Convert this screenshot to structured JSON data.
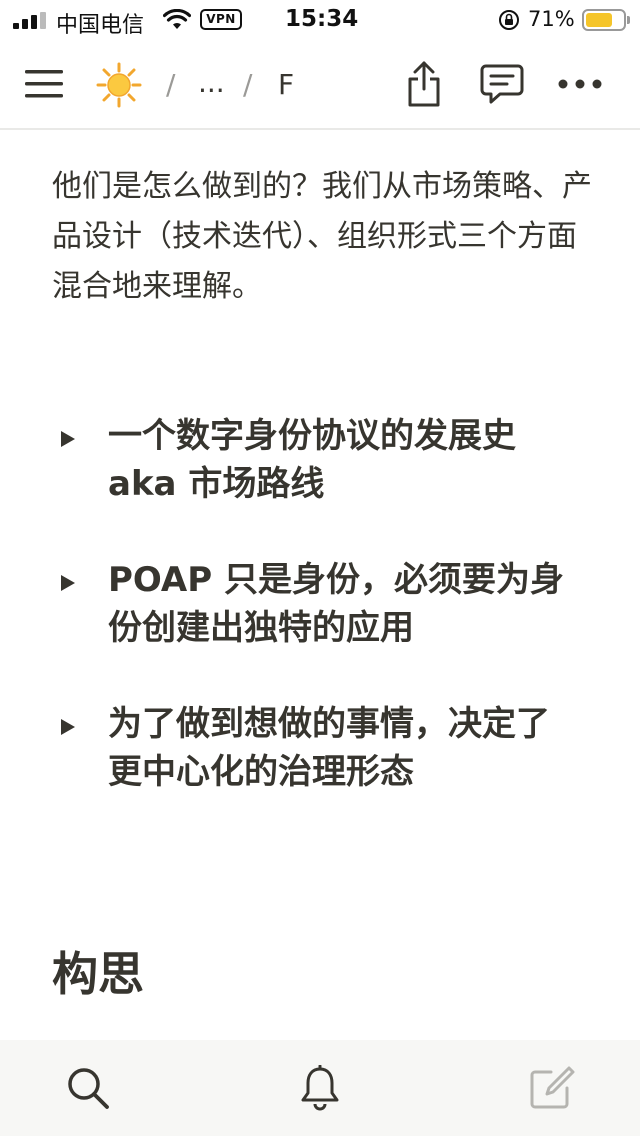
{
  "status_bar": {
    "carrier": "中国电信",
    "vpn_label": "VPN",
    "time": "15:34",
    "battery_percent": "71%",
    "battery_level": 0.71,
    "icons": [
      "signal-icon",
      "wifi-icon",
      "rotation-lock-icon",
      "battery-icon"
    ]
  },
  "nav_bar": {
    "breadcrumb_separator": "/",
    "breadcrumb_ellipsis": "...",
    "current_page_partial": "F",
    "icons": [
      "menu-icon",
      "sun-emoji-icon",
      "share-icon",
      "comment-icon",
      "more-icon"
    ]
  },
  "content": {
    "paragraph": "他们是怎么做到的？我们从市场策略、产品设计（技术迭代）、组织形式三个方面混合地来理解。",
    "toggles": [
      {
        "title": "一个数字身份协议的发展史 aka 市场路线"
      },
      {
        "title": "POAP 只是身份，必须要为身份创建出独特的应用"
      },
      {
        "title": "为了做到想做的事情，决定了更中心化的治理形态"
      }
    ],
    "heading": "构思"
  },
  "bottom_bar": {
    "icons": [
      "search-icon",
      "bell-icon",
      "compose-icon"
    ]
  },
  "colors": {
    "text": "#37352f",
    "muted": "#9b9a97",
    "battery": "#f5c52a",
    "toolbar_bg": "#f7f7f5"
  }
}
